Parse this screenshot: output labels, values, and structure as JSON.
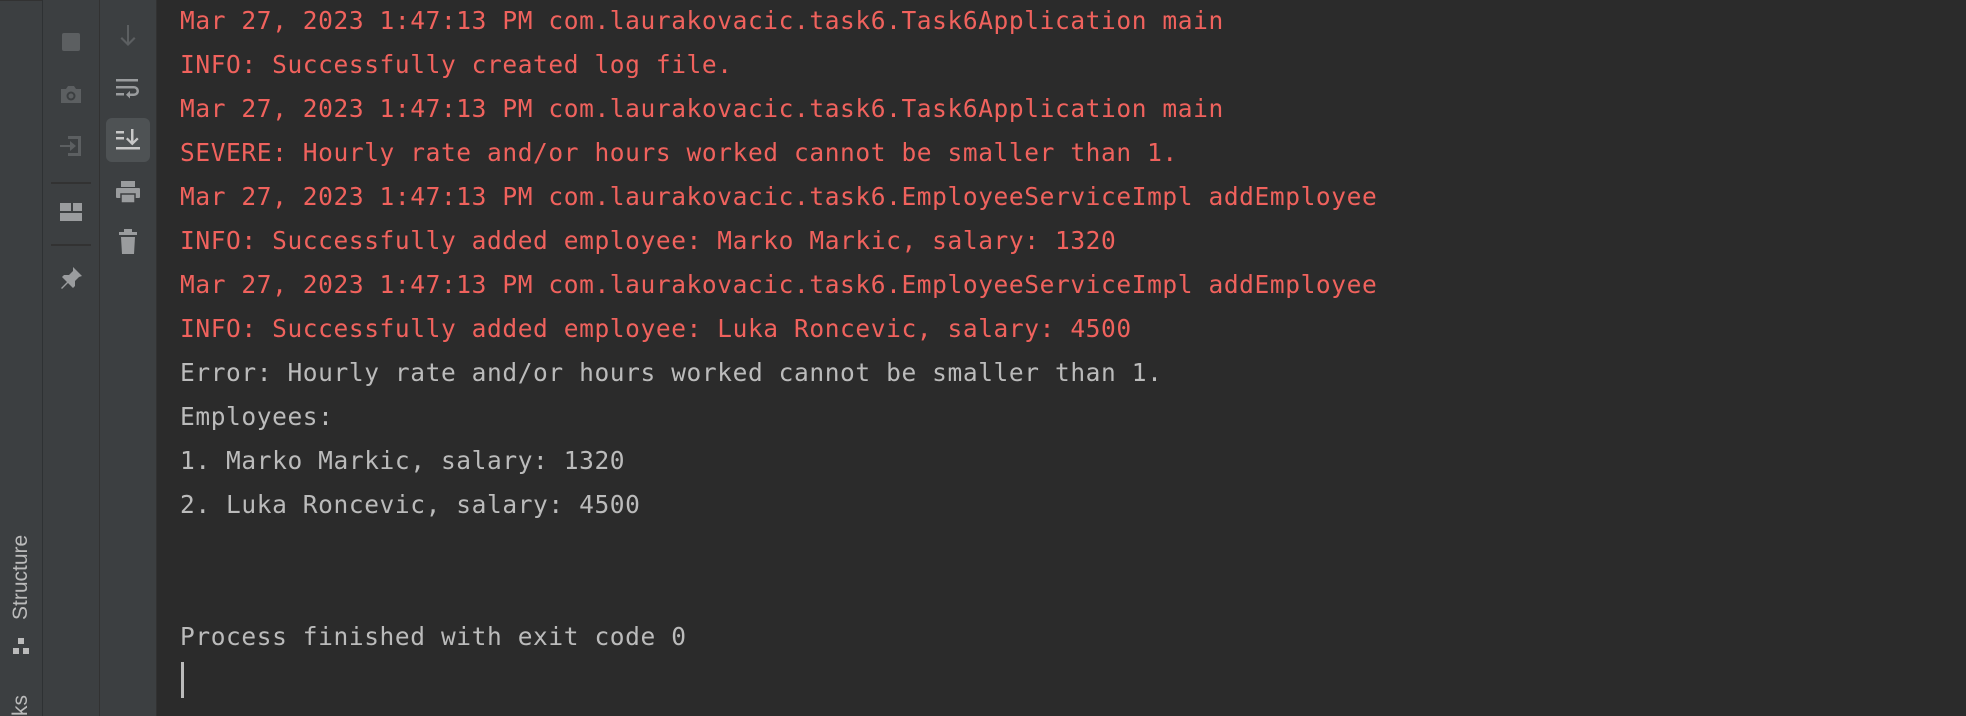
{
  "side_strip": {
    "structure_label": "Structure",
    "bottom_label": "ks"
  },
  "toolbar_left": {
    "icons": [
      "stop-icon",
      "camera-icon",
      "login-icon",
      "layout-icon",
      "pin-icon"
    ]
  },
  "toolbar_right": {
    "icons": [
      "down-arrow-icon",
      "soft-wrap-icon",
      "scroll-to-end-icon",
      "print-icon",
      "trash-icon"
    ]
  },
  "colors": {
    "error_text": "#f0625d",
    "normal_text": "#bbbbbb",
    "background": "#2b2b2b",
    "toolbar_bg": "#3c3f41"
  },
  "console": {
    "lines": [
      "Mar 27, 2023 1:47:13 PM com.laurakovacic.task6.Task6Application main",
      "INFO: Successfully created log file.",
      "Mar 27, 2023 1:47:13 PM com.laurakovacic.task6.Task6Application main",
      "SEVERE: Hourly rate and/or hours worked cannot be smaller than 1.",
      "Mar 27, 2023 1:47:13 PM com.laurakovacic.task6.EmployeeServiceImpl addEmployee",
      "INFO: Successfully added employee: Marko Markic, salary: 1320",
      "Mar 27, 2023 1:47:13 PM com.laurakovacic.task6.EmployeeServiceImpl addEmployee",
      "INFO: Successfully added employee: Luka Roncevic, salary: 4500",
      "Error: Hourly rate and/or hours worked cannot be smaller than 1.",
      "Employees:",
      "1. Marko Markic, salary: 1320",
      "2. Luka Roncevic, salary: 4500",
      "",
      "",
      "Process finished with exit code 0"
    ]
  }
}
